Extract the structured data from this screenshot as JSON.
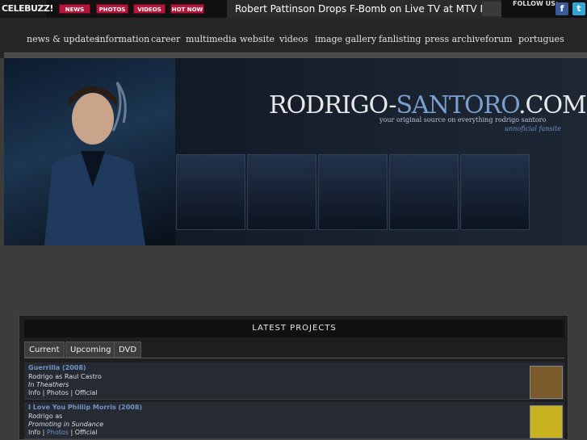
{
  "topbar": {
    "logo": "CELEBUZZ!",
    "nav": [
      "NEWS",
      "PHOTOS",
      "VIDEOS",
      "HOT NOW"
    ],
    "headline": "Robert Pattinson Drops F-Bomb on Live TV at MTV Movie",
    "follow_label": "FOLLOW US:",
    "social": [
      "f",
      "t"
    ]
  },
  "sitenav": [
    "news & updates",
    "information",
    "career",
    "multimedia",
    "website",
    "videos",
    "image gallery",
    "fanlisting",
    "press archive",
    "forum",
    "portugues"
  ],
  "banner": {
    "title_a": "RODRIGO-",
    "title_b": "SANTORO",
    "title_c": ".COM",
    "tagline": "your original source on everything rodrigo santoro",
    "subtag": "unnoficial fansite"
  },
  "projects": {
    "heading": "LATEST PROJECTS",
    "tabs": [
      "Current",
      "Upcoming",
      "DVD"
    ],
    "items": [
      {
        "title": "Guerrilla (2008)",
        "role": "Rodrigo as Raul Castro",
        "status": "In Theathers",
        "links": [
          "Info",
          "Photos",
          "Official"
        ],
        "cover_color": "#7a5a2a"
      },
      {
        "title": "I Love You Phillip Morris (2008)",
        "role": "Rodrigo as",
        "status": "Promoting in Sundance",
        "links": [
          "Info",
          "Photos",
          "Official"
        ],
        "cover_color": "#c9b21f"
      }
    ]
  },
  "colors": {
    "accent": "#6f93c8",
    "nav_red": "#b5163a"
  }
}
